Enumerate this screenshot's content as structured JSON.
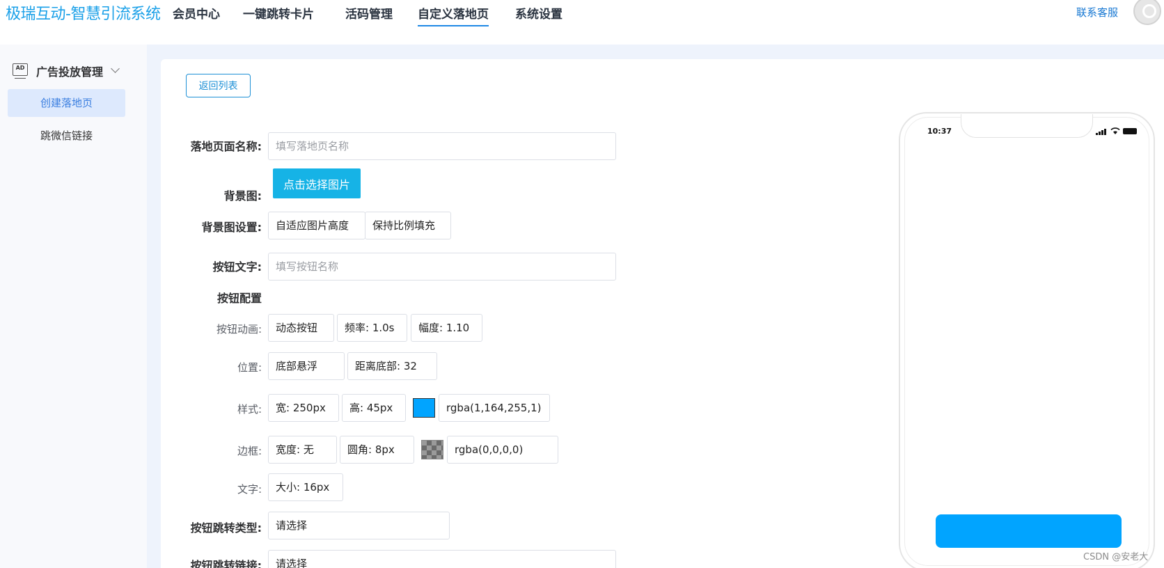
{
  "brand": "极瑞互动-智慧引流系统",
  "nav": {
    "items": [
      "会员中心",
      "一键跳转卡片",
      "活码管理",
      "自定义落地页",
      "系统设置"
    ],
    "active_index": 3,
    "contact": "联系客服"
  },
  "sidebar": {
    "group_icon": "AD",
    "group_label": "广告投放管理",
    "items": [
      {
        "label": "创建落地页",
        "active": true
      },
      {
        "label": "跳微信链接",
        "active": false
      }
    ]
  },
  "form": {
    "back_button": "返回列表",
    "page_name": {
      "label": "落地页面名称:",
      "placeholder": "填写落地页名称"
    },
    "bg_image": {
      "label": "背景图:",
      "button": "点击选择图片"
    },
    "bg_setting": {
      "label": "背景图设置:",
      "option1": "自适应图片高度",
      "option2": "保持比例填充"
    },
    "button_text": {
      "label": "按钮文字:",
      "placeholder": "填写按钮名称"
    },
    "button_config_title": "按钮配置",
    "animation": {
      "label": "按钮动画:",
      "type": "动态按钮",
      "frequency": "频率: 1.0s",
      "amplitude": "幅度: 1.10"
    },
    "position": {
      "label": "位置:",
      "mode": "底部悬浮",
      "distance": "距离底部: 32"
    },
    "style": {
      "label": "样式:",
      "width": "宽: 250px",
      "height": "高: 45px",
      "color_value": "rgba(1,164,255,1)",
      "swatch_color": "#01a4ff"
    },
    "border": {
      "label": "边框:",
      "width": "宽度: 无",
      "radius": "圆角: 8px",
      "color_value": "rgba(0,0,0,0)"
    },
    "text": {
      "label": "文字:",
      "size": "大小: 16px"
    },
    "jump_type": {
      "label": "按钮跳转类型:",
      "value": "请选择"
    },
    "jump_link": {
      "label": "按钮跳转链接:",
      "value": "请选择"
    }
  },
  "preview": {
    "time": "10:37",
    "button_color": "#01a4ff"
  },
  "watermark": "CSDN @安老大"
}
